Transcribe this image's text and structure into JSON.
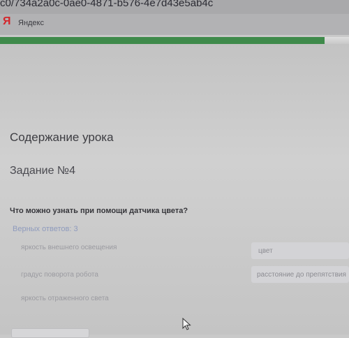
{
  "browser": {
    "url_fragment": "c0/734a2a0c-0ae0-4871-b576-4e7d43e5ab4c",
    "bookmark_logo": "Я",
    "bookmark_label": "Яндекс",
    "progress_percent": 93
  },
  "lesson": {
    "heading": "Содержание урока",
    "task_title": "Задание №4",
    "question": "Что можно узнать при помощи датчика цвета?",
    "correct_answers": "Верных ответов: 3",
    "left_options": [
      "яркость внешнего освещения",
      "градус поворота робота",
      "яркость отраженного света"
    ],
    "right_options": [
      "цвет",
      "расстояние до препятствия"
    ]
  },
  "colors": {
    "progress": "#3f8a4b",
    "yandex_red": "#d4262b"
  }
}
